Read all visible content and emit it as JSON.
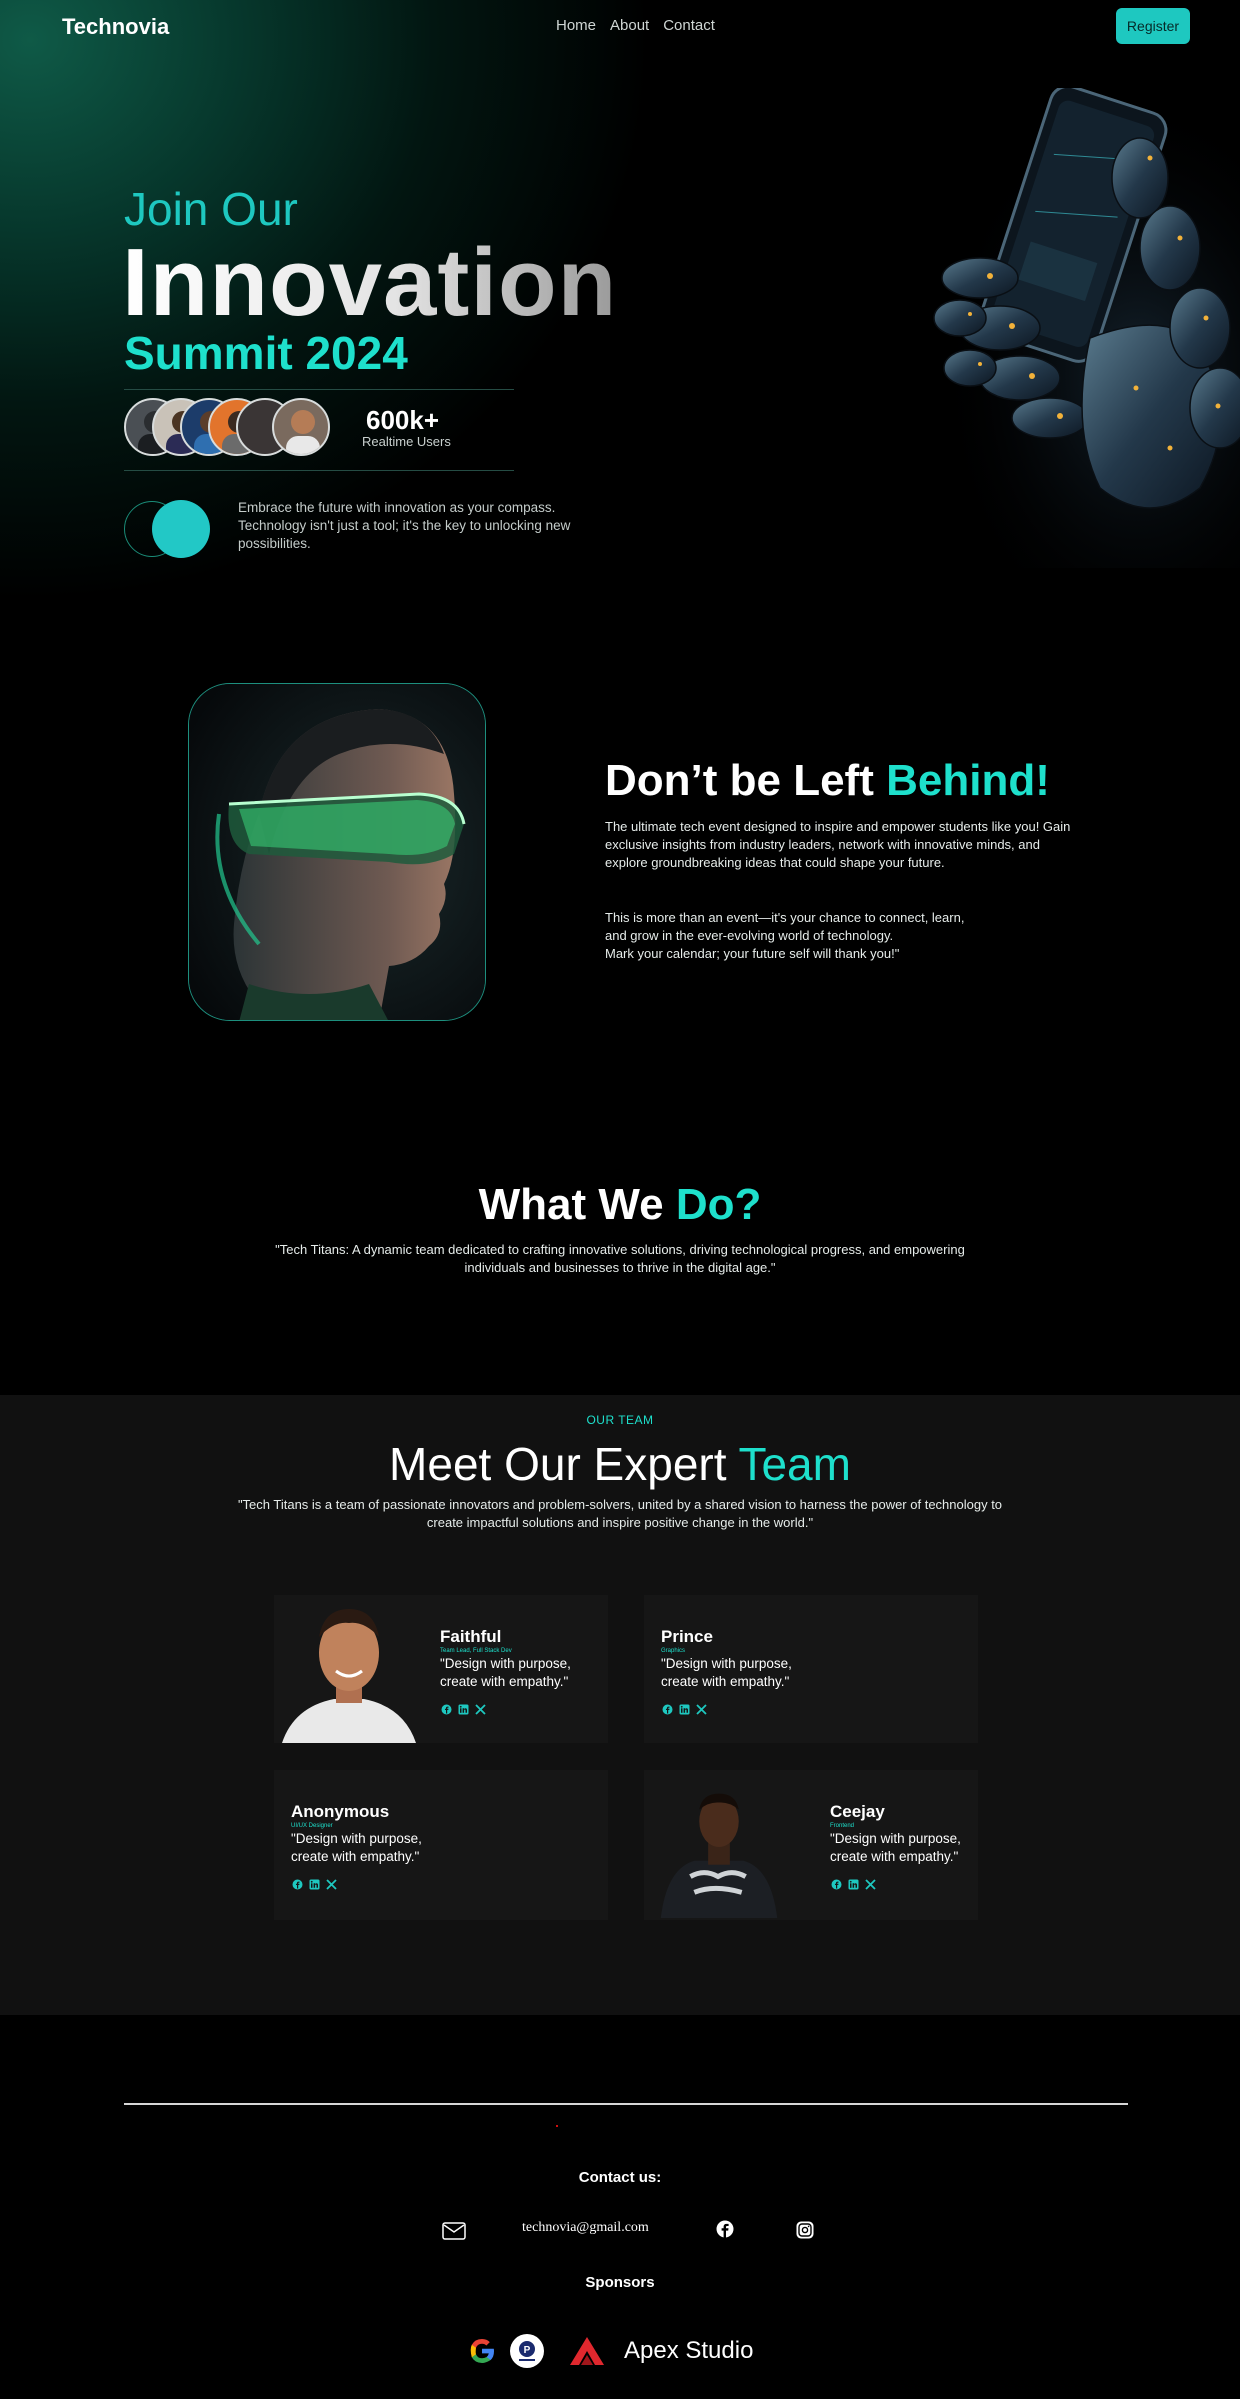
{
  "nav": {
    "brand": "Technovia",
    "links": [
      "Home",
      "About",
      "Contact"
    ],
    "register_label": "Register"
  },
  "hero": {
    "line1": "Join Our",
    "line2": "Innovation",
    "line3": "Summit 2024",
    "stat_value": "600k+",
    "stat_label": "Realtime Users",
    "description": "Embrace the future with innovation as your compass. Technology isn't just a tool; it's the key to unlocking new possibilities."
  },
  "behind": {
    "title_main": "Don’t be Left ",
    "title_accent": "Behind!",
    "p1": "The ultimate tech event designed to inspire and empower students like you! Gain exclusive insights from industry leaders, network with innovative minds, and explore groundbreaking ideas that could shape your future.",
    "p2_lines": [
      "This is more than an event—it's your chance to connect, learn,",
      "and grow in the ever-evolving world of technology.",
      "Mark your calendar; your future self will thank you!\""
    ]
  },
  "what": {
    "title_main": "What We ",
    "title_accent": "Do?",
    "text": "\"Tech Titans: A dynamic team dedicated to crafting innovative solutions, driving technological progress, and empowering individuals and businesses to thrive in the digital age.\""
  },
  "team": {
    "tag": "OUR TEAM",
    "title_main": "Meet Our Expert ",
    "title_accent": "Team",
    "text": "\"Tech Titans is a team of passionate innovators and problem-solvers, united by a shared vision to harness the power of technology to create impactful solutions and inspire positive change in the world.\"",
    "members": [
      {
        "name": "Faithful",
        "role": "Team Lead, Full Stack Dev",
        "quote": "\"Design with purpose, create with empathy.\""
      },
      {
        "name": "Prince",
        "role": "Graphics",
        "quote": "\"Design with purpose, create with empathy.\""
      },
      {
        "name": "Anonymous",
        "role": "UI/UX Designer",
        "quote": "\"Design with purpose, create with empathy.\""
      },
      {
        "name": "Ceejay",
        "role": "Frontend",
        "quote": "\"Design with purpose, create with empathy.\""
      }
    ]
  },
  "footer": {
    "contact_title": "Contact us:",
    "email": "technovia@gmail.com",
    "sponsors_title": "Sponsors",
    "sponsor_name": "Apex Studio"
  },
  "colors": {
    "accent": "#1ee0cc",
    "register_bg": "#1ec8c0",
    "team_bg": "#111111"
  }
}
